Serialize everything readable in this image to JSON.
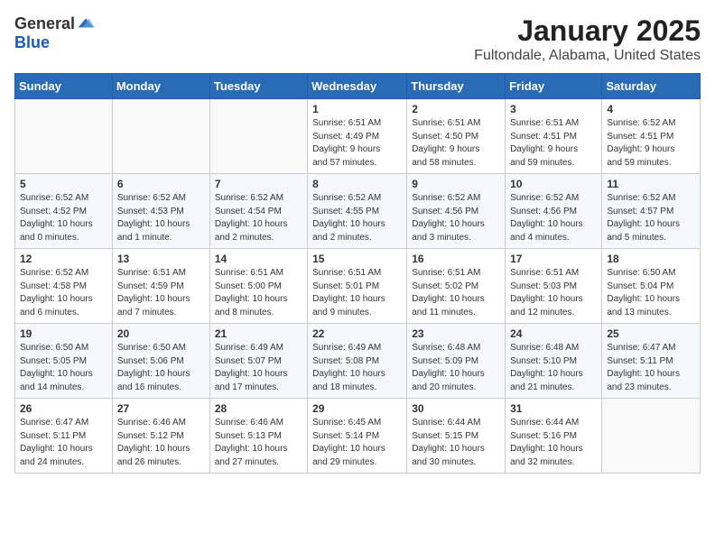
{
  "logo": {
    "general": "General",
    "blue": "Blue"
  },
  "title": "January 2025",
  "location": "Fultondale, Alabama, United States",
  "weekdays": [
    "Sunday",
    "Monday",
    "Tuesday",
    "Wednesday",
    "Thursday",
    "Friday",
    "Saturday"
  ],
  "weeks": [
    [
      {
        "day": "",
        "info": ""
      },
      {
        "day": "",
        "info": ""
      },
      {
        "day": "",
        "info": ""
      },
      {
        "day": "1",
        "info": "Sunrise: 6:51 AM\nSunset: 4:49 PM\nDaylight: 9 hours\nand 57 minutes."
      },
      {
        "day": "2",
        "info": "Sunrise: 6:51 AM\nSunset: 4:50 PM\nDaylight: 9 hours\nand 58 minutes."
      },
      {
        "day": "3",
        "info": "Sunrise: 6:51 AM\nSunset: 4:51 PM\nDaylight: 9 hours\nand 59 minutes."
      },
      {
        "day": "4",
        "info": "Sunrise: 6:52 AM\nSunset: 4:51 PM\nDaylight: 9 hours\nand 59 minutes."
      }
    ],
    [
      {
        "day": "5",
        "info": "Sunrise: 6:52 AM\nSunset: 4:52 PM\nDaylight: 10 hours\nand 0 minutes."
      },
      {
        "day": "6",
        "info": "Sunrise: 6:52 AM\nSunset: 4:53 PM\nDaylight: 10 hours\nand 1 minute."
      },
      {
        "day": "7",
        "info": "Sunrise: 6:52 AM\nSunset: 4:54 PM\nDaylight: 10 hours\nand 2 minutes."
      },
      {
        "day": "8",
        "info": "Sunrise: 6:52 AM\nSunset: 4:55 PM\nDaylight: 10 hours\nand 2 minutes."
      },
      {
        "day": "9",
        "info": "Sunrise: 6:52 AM\nSunset: 4:56 PM\nDaylight: 10 hours\nand 3 minutes."
      },
      {
        "day": "10",
        "info": "Sunrise: 6:52 AM\nSunset: 4:56 PM\nDaylight: 10 hours\nand 4 minutes."
      },
      {
        "day": "11",
        "info": "Sunrise: 6:52 AM\nSunset: 4:57 PM\nDaylight: 10 hours\nand 5 minutes."
      }
    ],
    [
      {
        "day": "12",
        "info": "Sunrise: 6:52 AM\nSunset: 4:58 PM\nDaylight: 10 hours\nand 6 minutes."
      },
      {
        "day": "13",
        "info": "Sunrise: 6:51 AM\nSunset: 4:59 PM\nDaylight: 10 hours\nand 7 minutes."
      },
      {
        "day": "14",
        "info": "Sunrise: 6:51 AM\nSunset: 5:00 PM\nDaylight: 10 hours\nand 8 minutes."
      },
      {
        "day": "15",
        "info": "Sunrise: 6:51 AM\nSunset: 5:01 PM\nDaylight: 10 hours\nand 9 minutes."
      },
      {
        "day": "16",
        "info": "Sunrise: 6:51 AM\nSunset: 5:02 PM\nDaylight: 10 hours\nand 11 minutes."
      },
      {
        "day": "17",
        "info": "Sunrise: 6:51 AM\nSunset: 5:03 PM\nDaylight: 10 hours\nand 12 minutes."
      },
      {
        "day": "18",
        "info": "Sunrise: 6:50 AM\nSunset: 5:04 PM\nDaylight: 10 hours\nand 13 minutes."
      }
    ],
    [
      {
        "day": "19",
        "info": "Sunrise: 6:50 AM\nSunset: 5:05 PM\nDaylight: 10 hours\nand 14 minutes."
      },
      {
        "day": "20",
        "info": "Sunrise: 6:50 AM\nSunset: 5:06 PM\nDaylight: 10 hours\nand 16 minutes."
      },
      {
        "day": "21",
        "info": "Sunrise: 6:49 AM\nSunset: 5:07 PM\nDaylight: 10 hours\nand 17 minutes."
      },
      {
        "day": "22",
        "info": "Sunrise: 6:49 AM\nSunset: 5:08 PM\nDaylight: 10 hours\nand 18 minutes."
      },
      {
        "day": "23",
        "info": "Sunrise: 6:48 AM\nSunset: 5:09 PM\nDaylight: 10 hours\nand 20 minutes."
      },
      {
        "day": "24",
        "info": "Sunrise: 6:48 AM\nSunset: 5:10 PM\nDaylight: 10 hours\nand 21 minutes."
      },
      {
        "day": "25",
        "info": "Sunrise: 6:47 AM\nSunset: 5:11 PM\nDaylight: 10 hours\nand 23 minutes."
      }
    ],
    [
      {
        "day": "26",
        "info": "Sunrise: 6:47 AM\nSunset: 5:11 PM\nDaylight: 10 hours\nand 24 minutes."
      },
      {
        "day": "27",
        "info": "Sunrise: 6:46 AM\nSunset: 5:12 PM\nDaylight: 10 hours\nand 26 minutes."
      },
      {
        "day": "28",
        "info": "Sunrise: 6:46 AM\nSunset: 5:13 PM\nDaylight: 10 hours\nand 27 minutes."
      },
      {
        "day": "29",
        "info": "Sunrise: 6:45 AM\nSunset: 5:14 PM\nDaylight: 10 hours\nand 29 minutes."
      },
      {
        "day": "30",
        "info": "Sunrise: 6:44 AM\nSunset: 5:15 PM\nDaylight: 10 hours\nand 30 minutes."
      },
      {
        "day": "31",
        "info": "Sunrise: 6:44 AM\nSunset: 5:16 PM\nDaylight: 10 hours\nand 32 minutes."
      },
      {
        "day": "",
        "info": ""
      }
    ]
  ]
}
